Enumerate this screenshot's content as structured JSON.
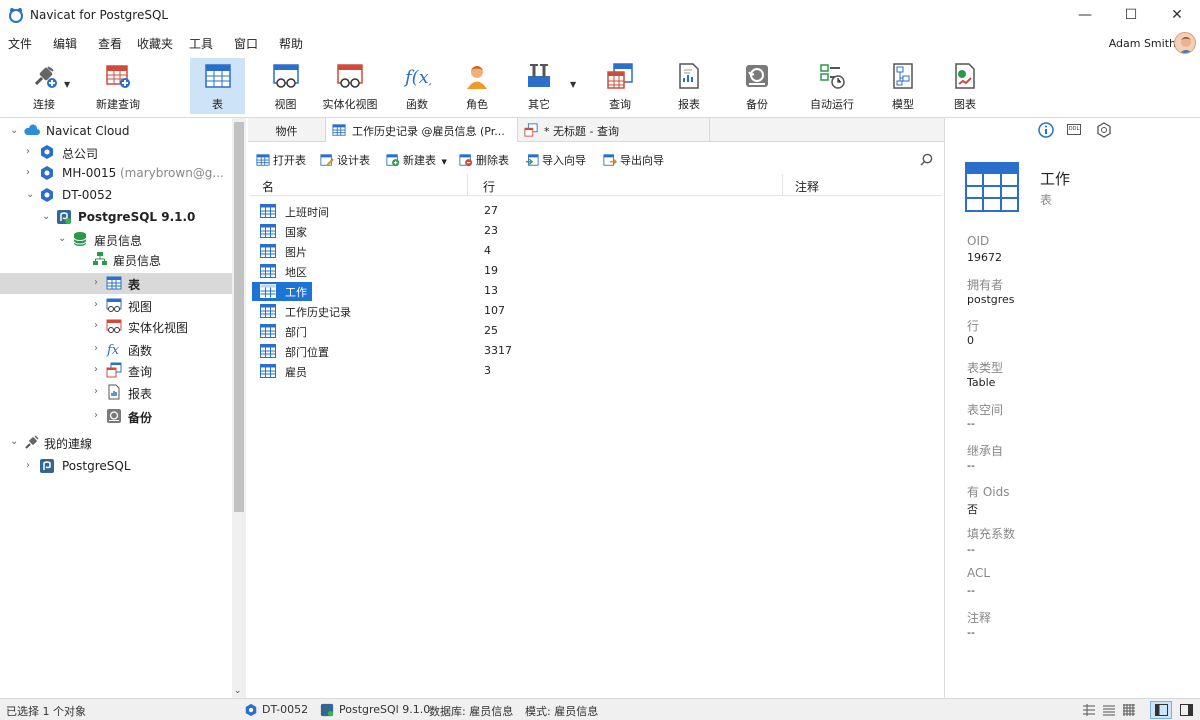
{
  "app": {
    "title": "Navicat for PostgreSQL"
  },
  "window": {
    "minimize": "—",
    "maximize": "☐",
    "close": "✕"
  },
  "menu": [
    "文件",
    "编辑",
    "查看",
    "收藏夹",
    "工具",
    "窗口",
    "帮助"
  ],
  "user": {
    "name": "Adam Smith"
  },
  "toolbar": [
    {
      "label": "连接",
      "icon": "plug-icon"
    },
    {
      "label": "新建查询",
      "icon": "new-query-icon"
    },
    {
      "label": "表",
      "icon": "table-icon",
      "active": true
    },
    {
      "label": "视图",
      "icon": "view-icon"
    },
    {
      "label": "实体化视图",
      "icon": "materialized-view-icon"
    },
    {
      "label": "函数",
      "icon": "function-icon"
    },
    {
      "label": "角色",
      "icon": "role-icon"
    },
    {
      "label": "其它",
      "icon": "tools-icon"
    },
    {
      "label": "查询",
      "icon": "query-icon"
    },
    {
      "label": "报表",
      "icon": "report-icon"
    },
    {
      "label": "备份",
      "icon": "backup-icon"
    },
    {
      "label": "自动运行",
      "icon": "automation-icon"
    },
    {
      "label": "模型",
      "icon": "model-icon"
    },
    {
      "label": "图表",
      "icon": "chart-icon"
    }
  ],
  "tree": [
    {
      "label": "Navicat Cloud",
      "icon": "cloud-icon"
    },
    {
      "label": "总公司",
      "icon": "project-icon"
    },
    {
      "label": "MH-0015",
      "sub": "(marybrown@g...",
      "icon": "project-icon"
    },
    {
      "label": "DT-0052",
      "icon": "project-icon"
    },
    {
      "label": "PostgreSQL 9.1.0",
      "icon": "postgres-icon"
    },
    {
      "label": "雇员信息",
      "icon": "database-icon"
    },
    {
      "label": "雇员信息",
      "icon": "schema-icon"
    },
    {
      "label": "表",
      "icon": "table-icon"
    },
    {
      "label": "视图",
      "icon": "view-icon"
    },
    {
      "label": "实体化视图",
      "icon": "materialized-view-icon"
    },
    {
      "label": "函数",
      "icon": "function-icon"
    },
    {
      "label": "查询",
      "icon": "query-icon"
    },
    {
      "label": "报表",
      "icon": "report-icon"
    },
    {
      "label": "备份",
      "icon": "backup-icon"
    },
    {
      "label": "我的連線",
      "icon": "connections-icon"
    },
    {
      "label": "PostgreSQL",
      "icon": "postgres-icon"
    }
  ],
  "tabs": [
    {
      "label": "物件"
    },
    {
      "label": "工作历史记录 @雇员信息 (Pr..."
    },
    {
      "label": "* 无标题 - 查询"
    }
  ],
  "objbar": [
    {
      "label": "打开表",
      "icon": "open-table-icon"
    },
    {
      "label": "设计表",
      "icon": "design-table-icon"
    },
    {
      "label": "新建表",
      "icon": "new-table-icon"
    },
    {
      "label": "删除表",
      "icon": "delete-table-icon"
    },
    {
      "label": "导入向导",
      "icon": "import-wizard-icon"
    },
    {
      "label": "导出向导",
      "icon": "export-wizard-icon"
    }
  ],
  "list": {
    "headers": [
      "名",
      "行",
      "注释"
    ],
    "rows": [
      {
        "name": "上班时间",
        "rows": "27"
      },
      {
        "name": "国家",
        "rows": "23"
      },
      {
        "name": "图片",
        "rows": "4"
      },
      {
        "name": "地区",
        "rows": "19"
      },
      {
        "name": "工作",
        "rows": "13"
      },
      {
        "name": "工作历史记录",
        "rows": "107"
      },
      {
        "name": "部门",
        "rows": "25"
      },
      {
        "name": "部门位置",
        "rows": "3317"
      },
      {
        "name": "雇员",
        "rows": "3"
      }
    ]
  },
  "panel": {
    "tabs": [
      "info-icon",
      "ddl-icon",
      "dependency-icon"
    ],
    "ddl": "DDL",
    "name": "工作",
    "type": "表",
    "props": [
      {
        "label": "OID",
        "value": "19672"
      },
      {
        "label": "拥有者",
        "value": "postgres"
      },
      {
        "label": "行",
        "value": "0"
      },
      {
        "label": "表类型",
        "value": "Table"
      },
      {
        "label": "表空间",
        "value": "--"
      },
      {
        "label": "继承自",
        "value": "--"
      },
      {
        "label": "有 Oids",
        "value": "否"
      },
      {
        "label": "填充系数",
        "value": "--"
      },
      {
        "label": "ACL",
        "value": "--"
      },
      {
        "label": "注释",
        "value": "--"
      }
    ]
  },
  "status": {
    "selected": "已选择 1 个对象",
    "connection": "DT-0052",
    "server": "PostgreSQl 9.1.0",
    "database": "数据库: 雇员信息",
    "schema": "模式: 雇员信息"
  }
}
